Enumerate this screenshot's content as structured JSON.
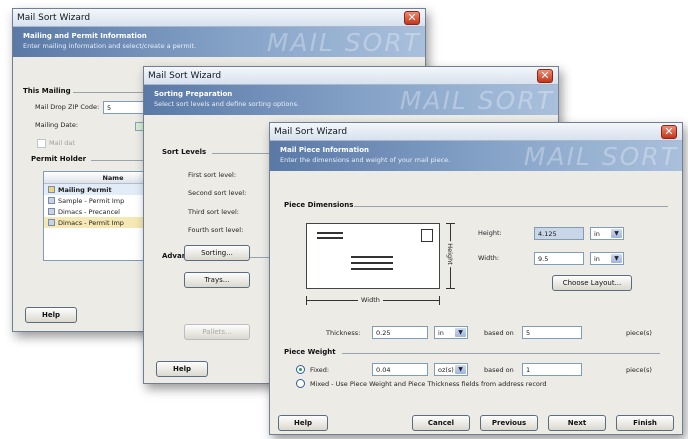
{
  "win1": {
    "title": "Mail Sort Wizard",
    "watermark": "MAIL SORT",
    "banner_title": "Mailing and Permit Information",
    "banner_sub": "Enter mailing information and select/create a permit.",
    "this_mailing": "This Mailing",
    "zip_label": "Mail Drop ZIP Code:",
    "zip_value": "5",
    "date_label": "Mailing Date:",
    "nonprofit_label": "Mail dat",
    "permit_holder": "Permit Holder",
    "list_header": "Name",
    "list_rows": [
      "Mailing Permit",
      "Sample - Permit Imp",
      "Dimacs - Precancel",
      "Dimacs - Permit Imp"
    ],
    "help": "Help"
  },
  "win2": {
    "title": "Mail Sort Wizard",
    "watermark": "MAIL SORT",
    "banner_title": "Sorting Preparation",
    "banner_sub": "Select sort levels and define sorting options.",
    "sort_levels": "Sort Levels",
    "level1": "First sort level:",
    "level2": "Second sort level:",
    "level3": "Third sort level:",
    "level4": "Fourth sort level:",
    "advanced": "Advanced Options",
    "sorting_btn": "Sorting...",
    "trays_btn": "Trays...",
    "pallets_btn": "Pallets...",
    "help": "Help"
  },
  "win3": {
    "title": "Mail Sort Wizard",
    "watermark": "MAIL SORT",
    "banner_title": "Mail Piece Information",
    "banner_sub": "Enter the dimensions and weight of your mail piece.",
    "piece_dimensions": "Piece Dimensions",
    "height_label": "Height:",
    "height_value": "4.125",
    "height_unit": "in",
    "width_label": "Width:",
    "width_value": "9.5",
    "width_unit": "in",
    "choose_layout": "Choose Layout...",
    "diagram_height": "Height",
    "diagram_width": "Width",
    "thickness_label": "Thickness:",
    "thickness_value": "0.25",
    "thickness_unit": "in",
    "based_on": "based on",
    "thickness_pieces": "5",
    "pieces_suffix": "piece(s)",
    "piece_weight": "Piece Weight",
    "fixed_label": "Fixed:",
    "weight_value": "0.04",
    "weight_unit": "oz(s)",
    "weight_pieces": "1",
    "mixed_label": "Mixed - Use Piece Weight and Piece Thickness fields from address record",
    "help": "Help",
    "cancel": "Cancel",
    "previous": "Previous",
    "next": "Next",
    "finish": "Finish"
  }
}
